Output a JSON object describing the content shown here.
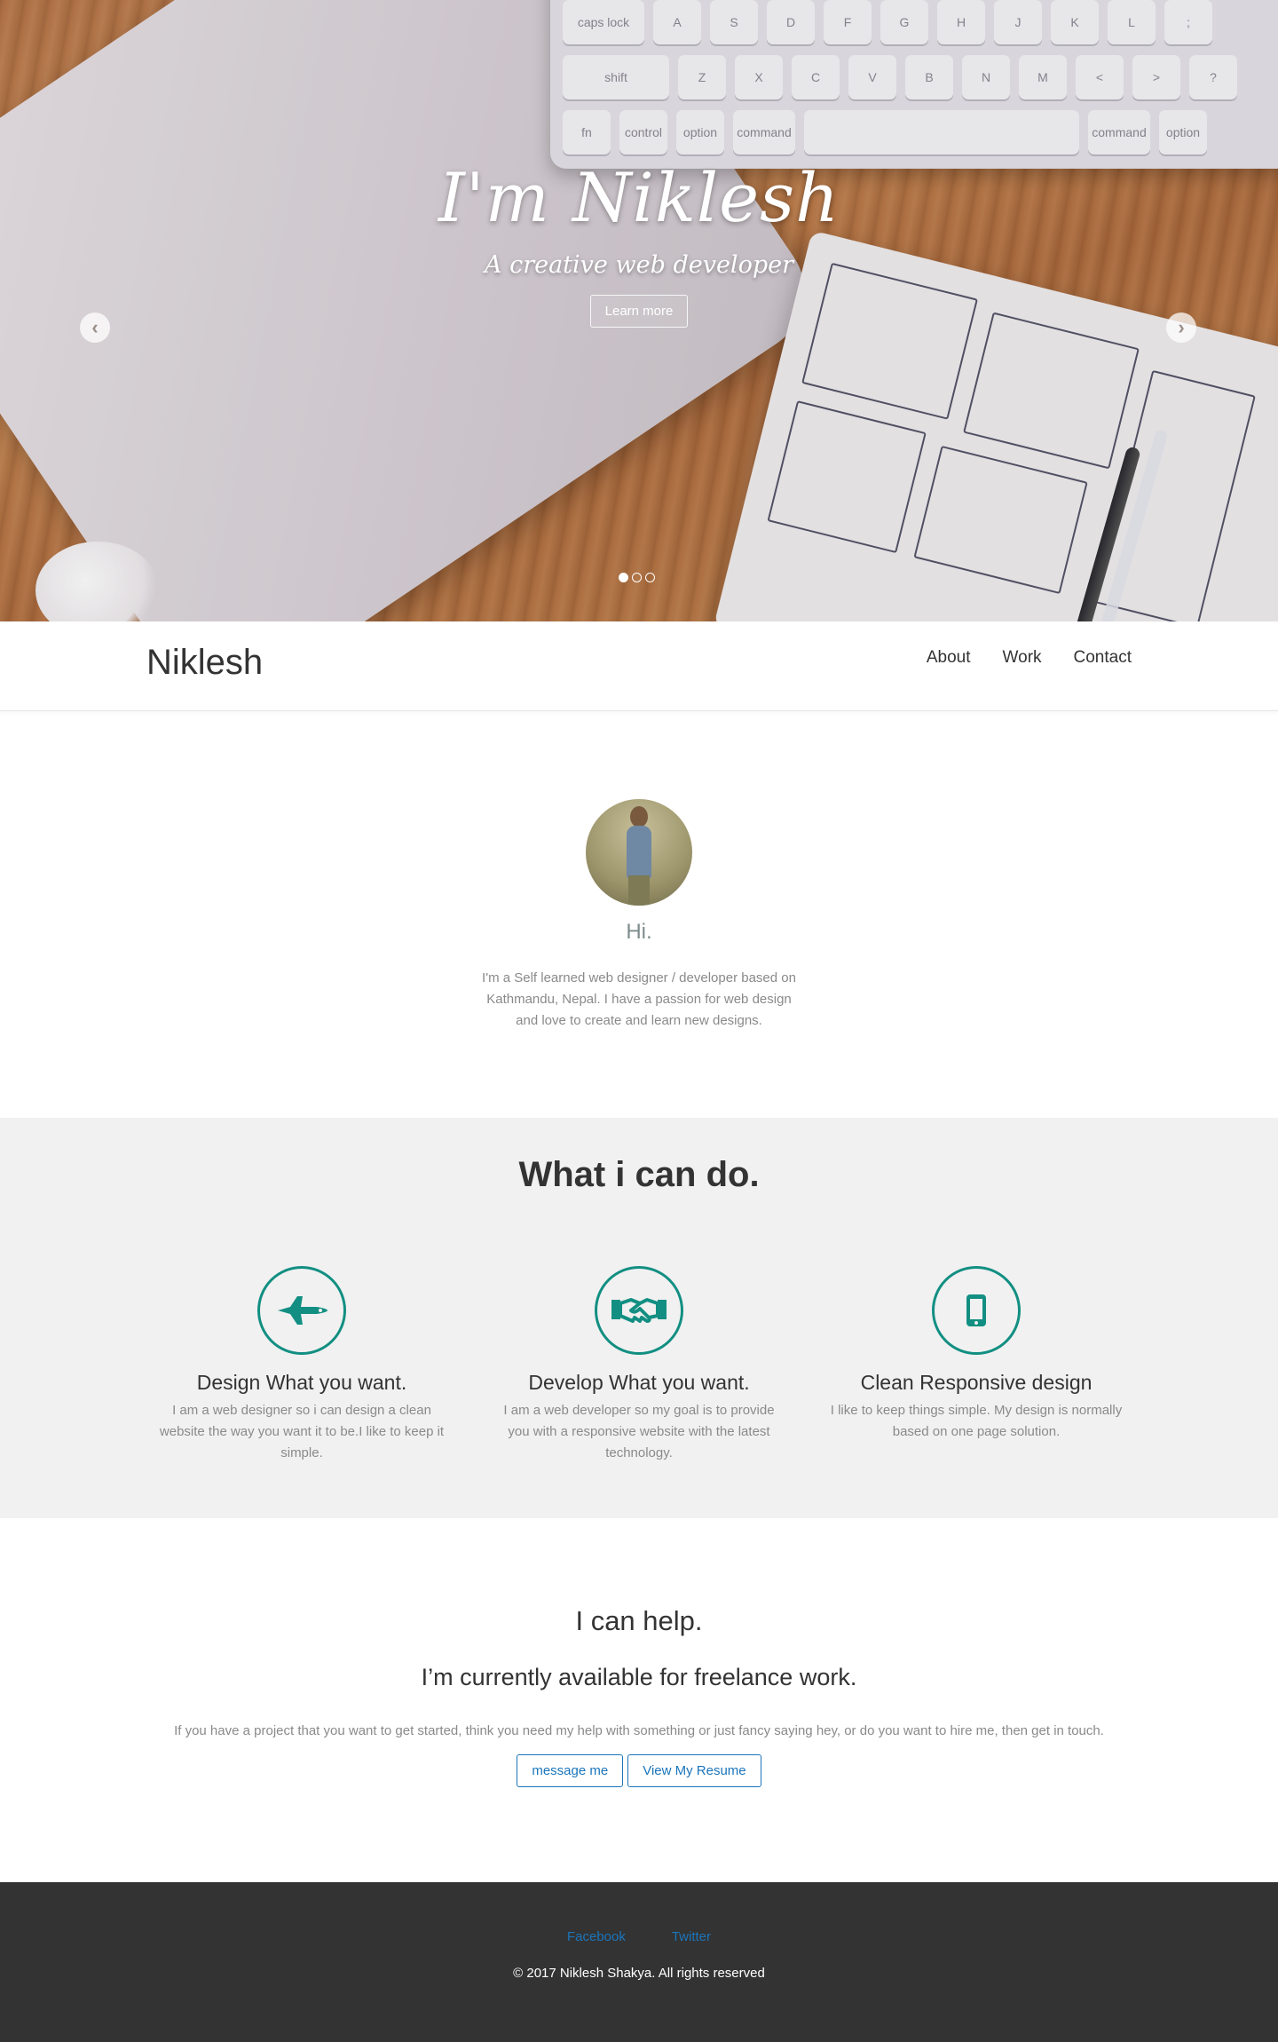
{
  "hero": {
    "title": "I'm Niklesh",
    "subtitle": "A creative web developer",
    "button_label": "Learn more",
    "prev_icon": "chevron-left-icon",
    "next_icon": "chevron-right-icon",
    "slides": 3,
    "active_slide": 1,
    "keyboard_keys_row1": [
      "caps lock",
      "A",
      "S",
      "D",
      "F",
      "G",
      "H",
      "J",
      "K",
      "L",
      ";"
    ],
    "keyboard_keys_row2": [
      "shift",
      "Z",
      "X",
      "C",
      "V",
      "B",
      "N",
      "M",
      "<",
      ">",
      "?"
    ],
    "keyboard_keys_row3": [
      "fn",
      "control",
      "option",
      "command",
      "command",
      "option"
    ]
  },
  "navbar": {
    "brand": "Niklesh",
    "links": [
      "About",
      "Work",
      "Contact"
    ]
  },
  "about": {
    "greeting": "Hi.",
    "text": "I'm a Self learned web designer / developer based on Kathmandu, Nepal. I have a passion for web design and love to create and learn new designs."
  },
  "services": {
    "heading": "What i can do.",
    "accent_color": "#128f82",
    "items": [
      {
        "icon": "jet-icon",
        "title": "Design What you want.",
        "text": "I am a web designer so i can design a clean website the way you want it to be.I like to keep it simple."
      },
      {
        "icon": "handshake-icon",
        "title": "Develop What you want.",
        "text": "I am a web developer so my goal is to provide you with a responsive website with the latest technology."
      },
      {
        "icon": "mobile-icon",
        "title": "Clean Responsive design",
        "text": "I like to keep things simple. My design is normally based on one page solution."
      }
    ]
  },
  "help": {
    "heading": "I can help.",
    "subheading": "I’m currently available for freelance work.",
    "text": "If you have a project that you want to get started, think you need my help with something or just fancy saying hey, or do you want to hire me, then get in touch.",
    "buttons": [
      "message me",
      "View My Resume"
    ],
    "link_color": "#1b75bb"
  },
  "footer": {
    "links": [
      "Facebook",
      "Twitter"
    ],
    "copyright": "© 2017 Niklesh Shakya. All rights reserved",
    "background": "#333333"
  }
}
